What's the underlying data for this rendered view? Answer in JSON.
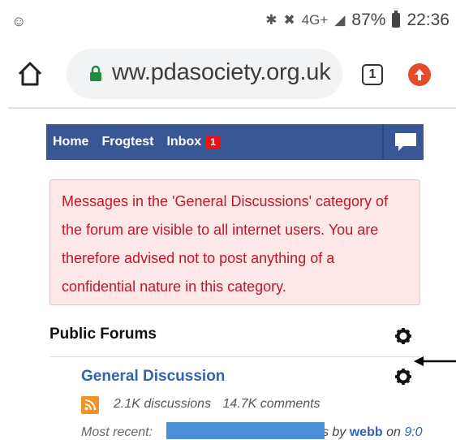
{
  "status_bar": {
    "signal_text": "4G+",
    "battery": "87%",
    "time": "22:36"
  },
  "browser": {
    "url": "ww.pdasociety.org.uk",
    "tab_count": "1"
  },
  "nav": {
    "items": [
      "Home",
      "Frogtest",
      "Inbox"
    ],
    "inbox_badge": "1"
  },
  "notice": {
    "text": "Messages in the 'General Discussions' category of the forum are visible to all internet users. You are therefore advised not to post anything of a confidential nature in this category."
  },
  "forums": {
    "heading": "Public Forums",
    "category": {
      "title": "General Discussion",
      "discussions": "2.1K discussions",
      "comments": "14.7K comments",
      "recent_label": "Most recent:",
      "recent_by": "s by",
      "recent_user": "webb",
      "recent_on": "on",
      "recent_time": "9:0"
    }
  },
  "colors": {
    "nav_bg": "#3a5795",
    "notice_bg": "#fde7e7",
    "notice_text": "#c0172b",
    "link": "#2f64b5"
  }
}
